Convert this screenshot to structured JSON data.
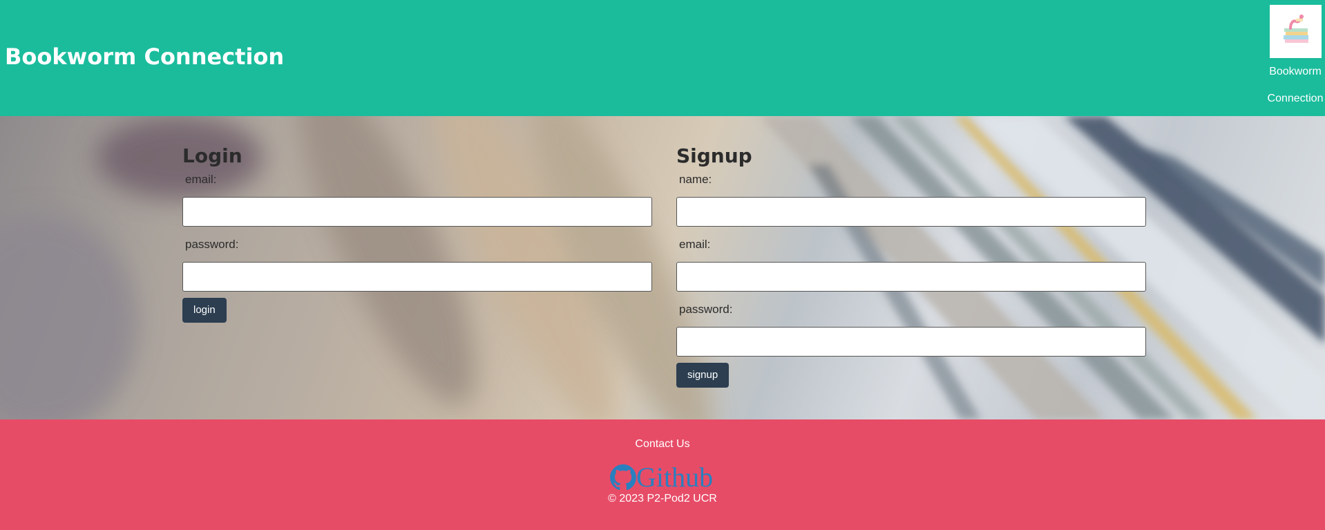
{
  "header": {
    "title": "Bookworm Connection",
    "logo_caption_line1": "Bookworm",
    "logo_caption_line2": "Connection"
  },
  "login": {
    "heading": "Login",
    "email_label": "email:",
    "email_value": "",
    "password_label": "password:",
    "password_value": "",
    "button_label": "login"
  },
  "signup": {
    "heading": "Signup",
    "name_label": "name:",
    "name_value": "",
    "email_label": "email:",
    "email_value": "",
    "password_label": "password:",
    "password_value": "",
    "button_label": "signup"
  },
  "footer": {
    "contact_label": "Contact Us",
    "github_label": "Github",
    "github_icon": "github-icon",
    "copyright": "© 2023 P2-Pod2 UCR"
  },
  "colors": {
    "header_bg": "#1abc9c",
    "footer_bg": "#e74c67",
    "button_bg": "#2c3e50",
    "github_blue": "#2a7fbf"
  }
}
